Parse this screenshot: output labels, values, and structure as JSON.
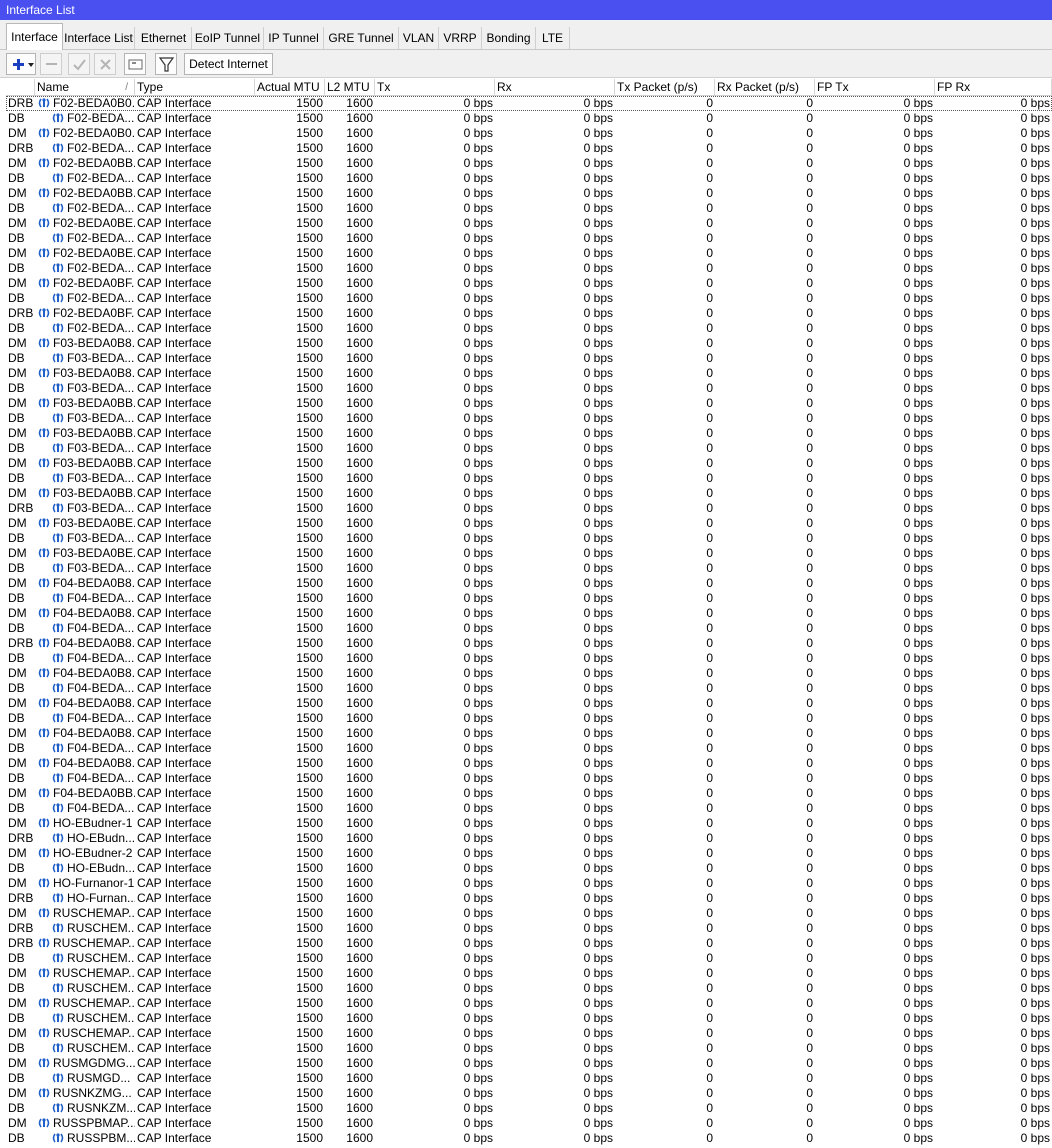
{
  "window": {
    "title": "Interface List"
  },
  "tabs": [
    {
      "label": "Interface",
      "active": true
    },
    {
      "label": "Interface List"
    },
    {
      "label": "Ethernet"
    },
    {
      "label": "EoIP Tunnel"
    },
    {
      "label": "IP Tunnel"
    },
    {
      "label": "GRE Tunnel"
    },
    {
      "label": "VLAN"
    },
    {
      "label": "VRRP"
    },
    {
      "label": "Bonding"
    },
    {
      "label": "LTE"
    }
  ],
  "toolbar": {
    "add": "plus-icon",
    "remove": "minus-icon",
    "enable": "check-icon",
    "disable": "cross-icon",
    "comment": "comment-icon",
    "filter": "filter-icon",
    "detect_internet": "Detect Internet"
  },
  "columns": [
    "Name",
    "Type",
    "Actual MTU",
    "L2 MTU",
    "Tx",
    "Rx",
    "Tx Packet (p/s)",
    "Rx Packet (p/s)",
    "FP Tx",
    "FP Rx"
  ],
  "sort_indicator": "/",
  "defaults": {
    "type": "CAP Interface",
    "actual_mtu": "1500",
    "l2_mtu": "1600",
    "tx": "0 bps",
    "rx": "0 bps",
    "tx_pps": "0",
    "rx_pps": "0",
    "fp_tx": "0 bps",
    "fp_rx": "0 bps"
  },
  "rows": [
    {
      "flags": "DRB",
      "name": "F02-BEDA0B0...",
      "child": false
    },
    {
      "flags": "DB",
      "name": "F02-BEDA...",
      "child": true
    },
    {
      "flags": "DM",
      "name": "F02-BEDA0B0...",
      "child": false
    },
    {
      "flags": "DRB",
      "name": "F02-BEDA...",
      "child": true
    },
    {
      "flags": "DM",
      "name": "F02-BEDA0BB...",
      "child": false
    },
    {
      "flags": "DB",
      "name": "F02-BEDA...",
      "child": true
    },
    {
      "flags": "DM",
      "name": "F02-BEDA0BB...",
      "child": false
    },
    {
      "flags": "DB",
      "name": "F02-BEDA...",
      "child": true
    },
    {
      "flags": "DM",
      "name": "F02-BEDA0BE...",
      "child": false
    },
    {
      "flags": "DB",
      "name": "F02-BEDA...",
      "child": true
    },
    {
      "flags": "DM",
      "name": "F02-BEDA0BE...",
      "child": false
    },
    {
      "flags": "DB",
      "name": "F02-BEDA...",
      "child": true
    },
    {
      "flags": "DM",
      "name": "F02-BEDA0BF...",
      "child": false
    },
    {
      "flags": "DB",
      "name": "F02-BEDA...",
      "child": true
    },
    {
      "flags": "DRB",
      "name": "F02-BEDA0BF...",
      "child": false
    },
    {
      "flags": "DB",
      "name": "F02-BEDA...",
      "child": true
    },
    {
      "flags": "DM",
      "name": "F03-BEDA0B8...",
      "child": false
    },
    {
      "flags": "DB",
      "name": "F03-BEDA...",
      "child": true
    },
    {
      "flags": "DM",
      "name": "F03-BEDA0B8...",
      "child": false
    },
    {
      "flags": "DB",
      "name": "F03-BEDA...",
      "child": true
    },
    {
      "flags": "DM",
      "name": "F03-BEDA0BB...",
      "child": false
    },
    {
      "flags": "DB",
      "name": "F03-BEDA...",
      "child": true
    },
    {
      "flags": "DM",
      "name": "F03-BEDA0BB...",
      "child": false
    },
    {
      "flags": "DB",
      "name": "F03-BEDA...",
      "child": true
    },
    {
      "flags": "DM",
      "name": "F03-BEDA0BB...",
      "child": false
    },
    {
      "flags": "DB",
      "name": "F03-BEDA...",
      "child": true
    },
    {
      "flags": "DM",
      "name": "F03-BEDA0BB...",
      "child": false
    },
    {
      "flags": "DRB",
      "name": "F03-BEDA...",
      "child": true
    },
    {
      "flags": "DM",
      "name": "F03-BEDA0BE...",
      "child": false
    },
    {
      "flags": "DB",
      "name": "F03-BEDA...",
      "child": true
    },
    {
      "flags": "DM",
      "name": "F03-BEDA0BE...",
      "child": false
    },
    {
      "flags": "DB",
      "name": "F03-BEDA...",
      "child": true
    },
    {
      "flags": "DM",
      "name": "F04-BEDA0B8...",
      "child": false
    },
    {
      "flags": "DB",
      "name": "F04-BEDA...",
      "child": true
    },
    {
      "flags": "DM",
      "name": "F04-BEDA0B8...",
      "child": false
    },
    {
      "flags": "DB",
      "name": "F04-BEDA...",
      "child": true
    },
    {
      "flags": "DRB",
      "name": "F04-BEDA0B8...",
      "child": false
    },
    {
      "flags": "DB",
      "name": "F04-BEDA...",
      "child": true
    },
    {
      "flags": "DM",
      "name": "F04-BEDA0B8...",
      "child": false
    },
    {
      "flags": "DB",
      "name": "F04-BEDA...",
      "child": true
    },
    {
      "flags": "DM",
      "name": "F04-BEDA0B8...",
      "child": false
    },
    {
      "flags": "DB",
      "name": "F04-BEDA...",
      "child": true
    },
    {
      "flags": "DM",
      "name": "F04-BEDA0B8...",
      "child": false
    },
    {
      "flags": "DB",
      "name": "F04-BEDA...",
      "child": true
    },
    {
      "flags": "DM",
      "name": "F04-BEDA0B8...",
      "child": false
    },
    {
      "flags": "DB",
      "name": "F04-BEDA...",
      "child": true
    },
    {
      "flags": "DM",
      "name": "F04-BEDA0BB...",
      "child": false
    },
    {
      "flags": "DB",
      "name": "F04-BEDA...",
      "child": true
    },
    {
      "flags": "DM",
      "name": "HO-EBudner-1",
      "child": false
    },
    {
      "flags": "DRB",
      "name": "HO-EBudn...",
      "child": true
    },
    {
      "flags": "DM",
      "name": "HO-EBudner-2",
      "child": false
    },
    {
      "flags": "DB",
      "name": "HO-EBudn...",
      "child": true
    },
    {
      "flags": "DM",
      "name": "HO-Furnanor-1",
      "child": false
    },
    {
      "flags": "DRB",
      "name": "HO-Furnan...",
      "child": true
    },
    {
      "flags": "DM",
      "name": "RUSCHEMAP...",
      "child": false
    },
    {
      "flags": "DRB",
      "name": "RUSCHEM...",
      "child": true
    },
    {
      "flags": "DRB",
      "name": "RUSCHEMAP...",
      "child": false
    },
    {
      "flags": "DB",
      "name": "RUSCHEM...",
      "child": true
    },
    {
      "flags": "DM",
      "name": "RUSCHEMAP...",
      "child": false
    },
    {
      "flags": "DB",
      "name": "RUSCHEM...",
      "child": true
    },
    {
      "flags": "DM",
      "name": "RUSCHEMAP...",
      "child": false
    },
    {
      "flags": "DB",
      "name": "RUSCHEM...",
      "child": true
    },
    {
      "flags": "DM",
      "name": "RUSCHEMAP...",
      "child": false
    },
    {
      "flags": "DB",
      "name": "RUSCHEM...",
      "child": true
    },
    {
      "flags": "DM",
      "name": "RUSMGDMG...",
      "child": false
    },
    {
      "flags": "DB",
      "name": "RUSMGD...",
      "child": true
    },
    {
      "flags": "DM",
      "name": "RUSNKZMG...",
      "child": false
    },
    {
      "flags": "DB",
      "name": "RUSNKZM...",
      "child": true
    },
    {
      "flags": "DM",
      "name": "RUSSPBMAP...",
      "child": false
    },
    {
      "flags": "DB",
      "name": "RUSSPBM...",
      "child": true
    }
  ],
  "colors": {
    "title_bar": "#4a4ff0",
    "icon_blue": "#1f5fc9",
    "plus_blue": "#1a3fbf"
  }
}
